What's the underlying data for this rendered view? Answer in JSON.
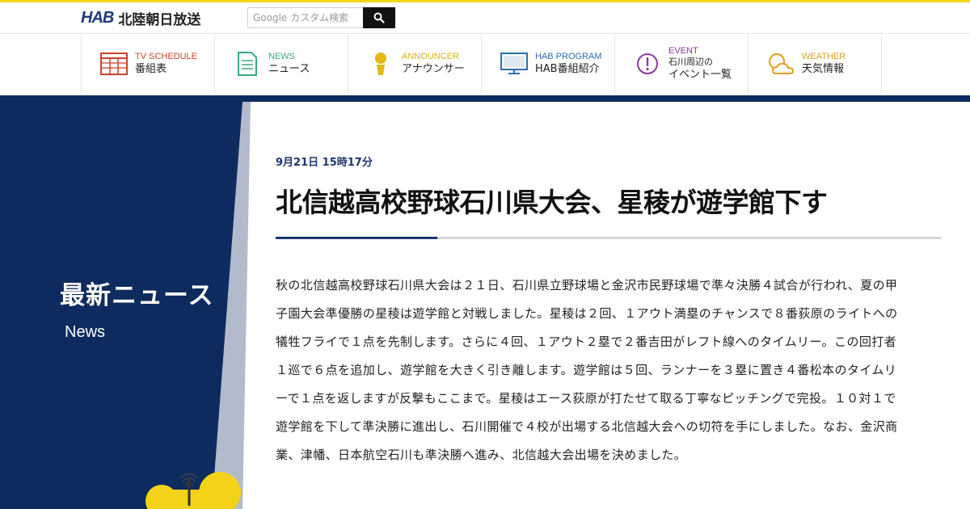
{
  "header": {
    "logo_mark": "HAB",
    "logo_text": "北陸朝日放送",
    "search_placeholder": "Google カスタム検索"
  },
  "nav": {
    "items": [
      {
        "en": "TV SCHEDULE",
        "jp": "番組表",
        "color": "#c8442a",
        "icon": "tv-schedule-icon"
      },
      {
        "en": "NEWS",
        "jp": "ニュース",
        "color": "#3aa883",
        "icon": "news-document-icon"
      },
      {
        "en": "ANNOUNCER",
        "jp": "アナウンサー",
        "color": "#d8b21a",
        "icon": "announcer-person-icon"
      },
      {
        "en": "HAB PROGRAM",
        "jp": "HAB番組紹介",
        "color": "#2a6fb0",
        "icon": "monitor-icon"
      },
      {
        "en": "EVENT",
        "jp1": "石川周辺の",
        "jp2": "イベント一覧",
        "color": "#8a3a9a",
        "icon": "exclamation-circle-icon"
      },
      {
        "en": "WEATHER",
        "jp": "天気情報",
        "color": "#e0a020",
        "icon": "sun-cloud-icon"
      }
    ]
  },
  "sidebar": {
    "title": "最新ニュース",
    "subtitle": "News",
    "panel_color": "#0d2b5e"
  },
  "article": {
    "date": "9月21日 15時17分",
    "title": "北信越高校野球石川県大会、星稜が遊学館下す",
    "body": "秋の北信越高校野球石川県大会は２１日、石川県立野球場と金沢市民野球場で準々決勝４試合が行われ、夏の甲子園大会準優勝の星稜は遊学館と対戦しました。星稜は２回、１アウト満塁のチャンスで８番荻原のライトへの犠牲フライで１点を先制します。さらに４回、１アウト２塁で２番吉田がレフト線へのタイムリー。この回打者１巡で６点を追加し、遊学館を大きく引き離します。遊学館は５回、ランナーを３塁に置き４番松本のタイムリーで１点を返しますが反撃もここまで。星稜はエース荻原が打たせて取る丁寧なピッチングで完投。１０対１で遊学館を下して準決勝に進出し、石川開催で４校が出場する北信越大会への切符を手にしました。なお、金沢商業、津幡、日本航空石川も準決勝へ進み、北信越大会出場を決めました。"
  }
}
